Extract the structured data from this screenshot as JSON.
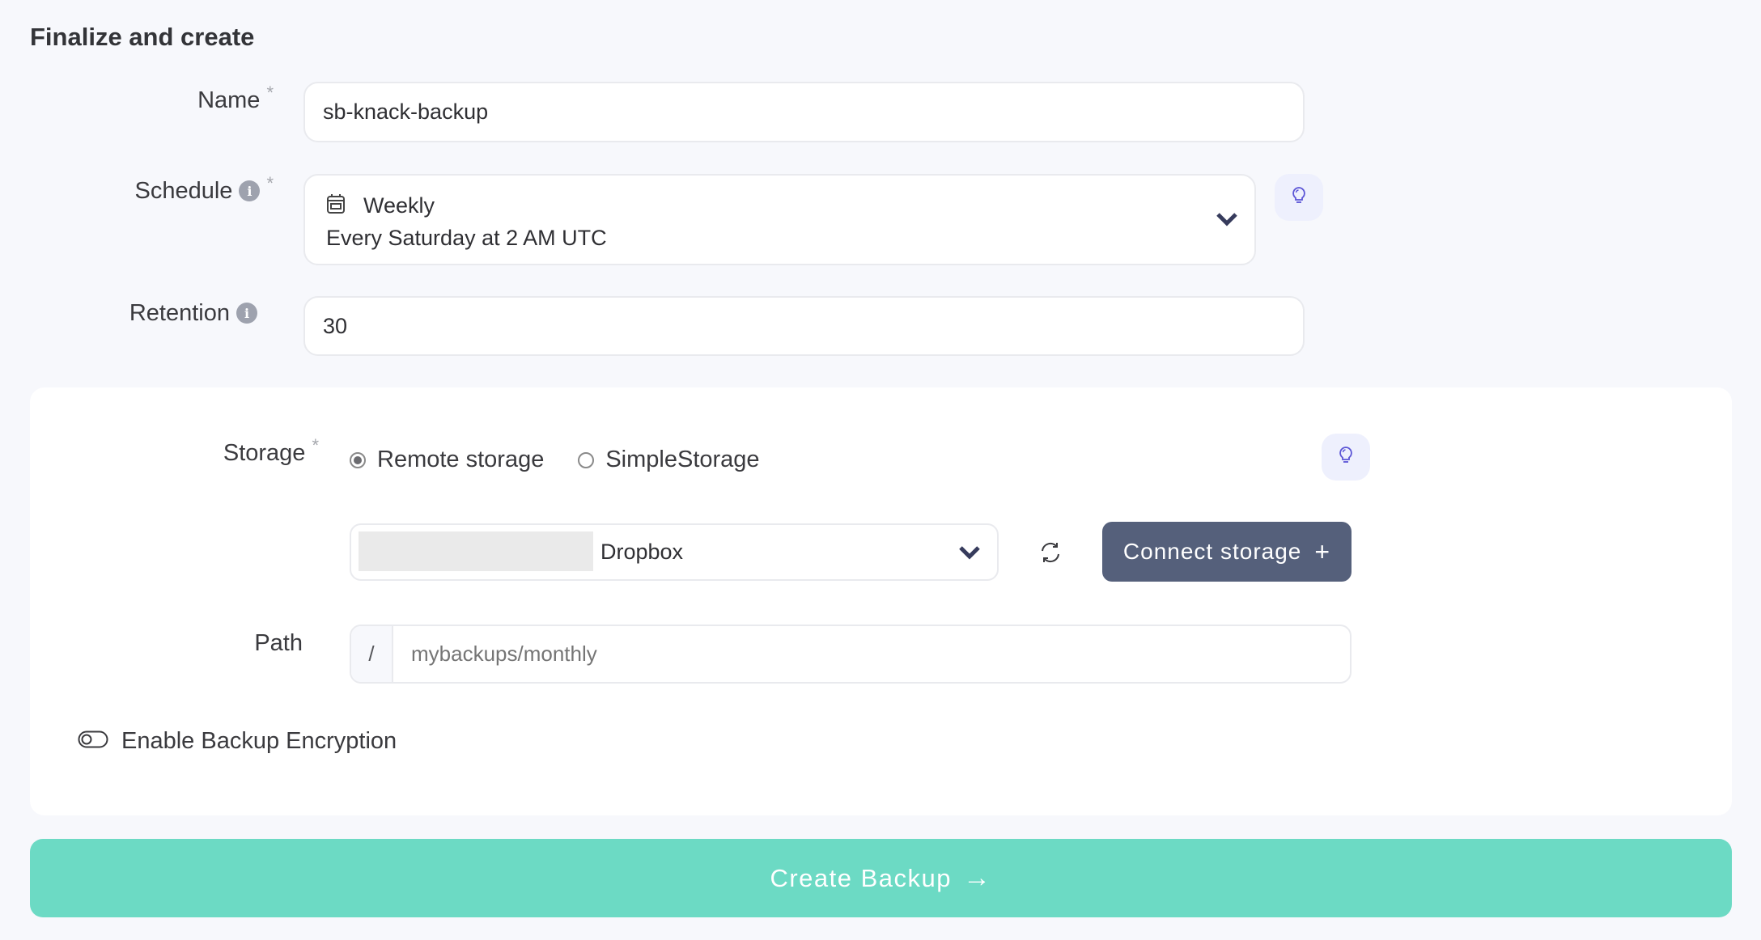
{
  "page": {
    "title": "Finalize and create"
  },
  "form": {
    "name": {
      "label": "Name",
      "required_mark": "*",
      "value": "sb-knack-backup"
    },
    "schedule": {
      "label": "Schedule",
      "required_mark": "*",
      "info_glyph": "i",
      "frequency": "Weekly",
      "description": "Every Saturday at 2 AM UTC",
      "icon": "calendar-icon",
      "tip_icon": "lightbulb-icon"
    },
    "retention": {
      "label": "Retention",
      "info_glyph": "i",
      "value": "30"
    },
    "storage": {
      "label": "Storage",
      "required_mark": "*",
      "options": [
        {
          "label": "Remote storage",
          "selected": true
        },
        {
          "label": "SimpleStorage",
          "selected": false
        }
      ],
      "selected_storage": "Dropbox",
      "tip_icon": "lightbulb-icon",
      "refresh_icon": "refresh-icon",
      "connect_label": "Connect storage",
      "connect_glyph": "+"
    },
    "path": {
      "label": "Path",
      "prefix": "/",
      "value": "",
      "placeholder": "mybackups/monthly"
    },
    "encryption": {
      "label": "Enable Backup Encryption",
      "enabled": false
    }
  },
  "actions": {
    "create_label": "Create Backup",
    "create_glyph": "→"
  },
  "colors": {
    "primary_button": "#6cdac4",
    "connect_button": "#55607b",
    "tip_bg": "#eef0fd",
    "tip_icon": "#5b55d6",
    "chevron": "#363b5c"
  }
}
